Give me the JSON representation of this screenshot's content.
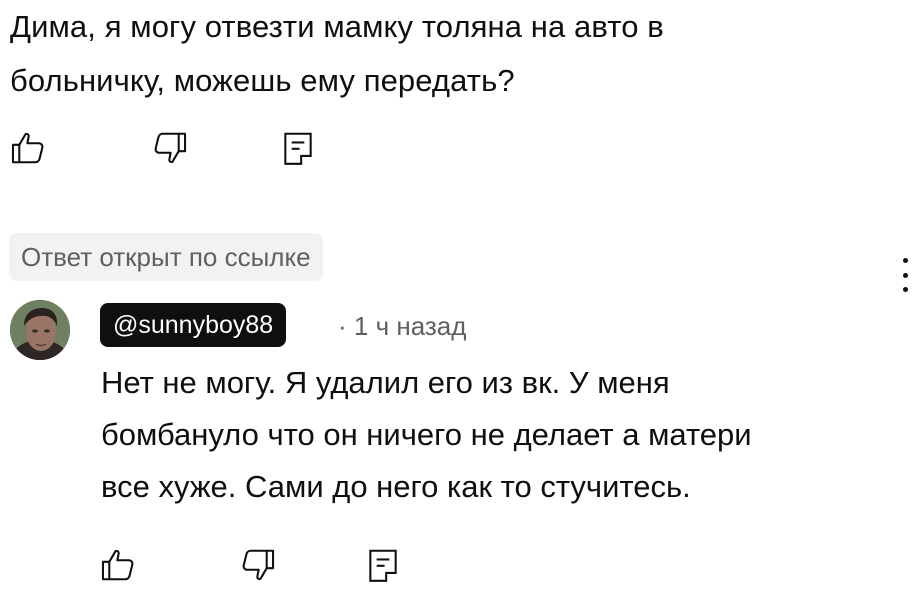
{
  "parent_comment": {
    "text": "Дима, я могу отвезти мамку толяна на авто в\nбольничку, можешь ему передать?",
    "actions": {
      "like_icon": "thumbs-up-icon",
      "dislike_icon": "thumbs-down-icon",
      "reply_icon": "reply-icon"
    }
  },
  "link_badge": "Ответ открыт по ссылке",
  "reply": {
    "author": "@sunnyboy88",
    "separator": "·",
    "time": "1 ч назад",
    "text": "Нет не могу. Я удалил его из вк. У меня\nбомбануло что он ничего не делает а матери\nвсе хуже. Сами до него как то стучитесь.",
    "actions": {
      "like_icon": "thumbs-up-icon",
      "dislike_icon": "thumbs-down-icon",
      "reply_icon": "reply-icon"
    }
  },
  "colors": {
    "text": "#0f0f0f",
    "secondary_text": "#606060",
    "badge_bg": "#f2f2f2",
    "chip_bg": "#0f0f0f",
    "chip_text": "#ffffff"
  }
}
